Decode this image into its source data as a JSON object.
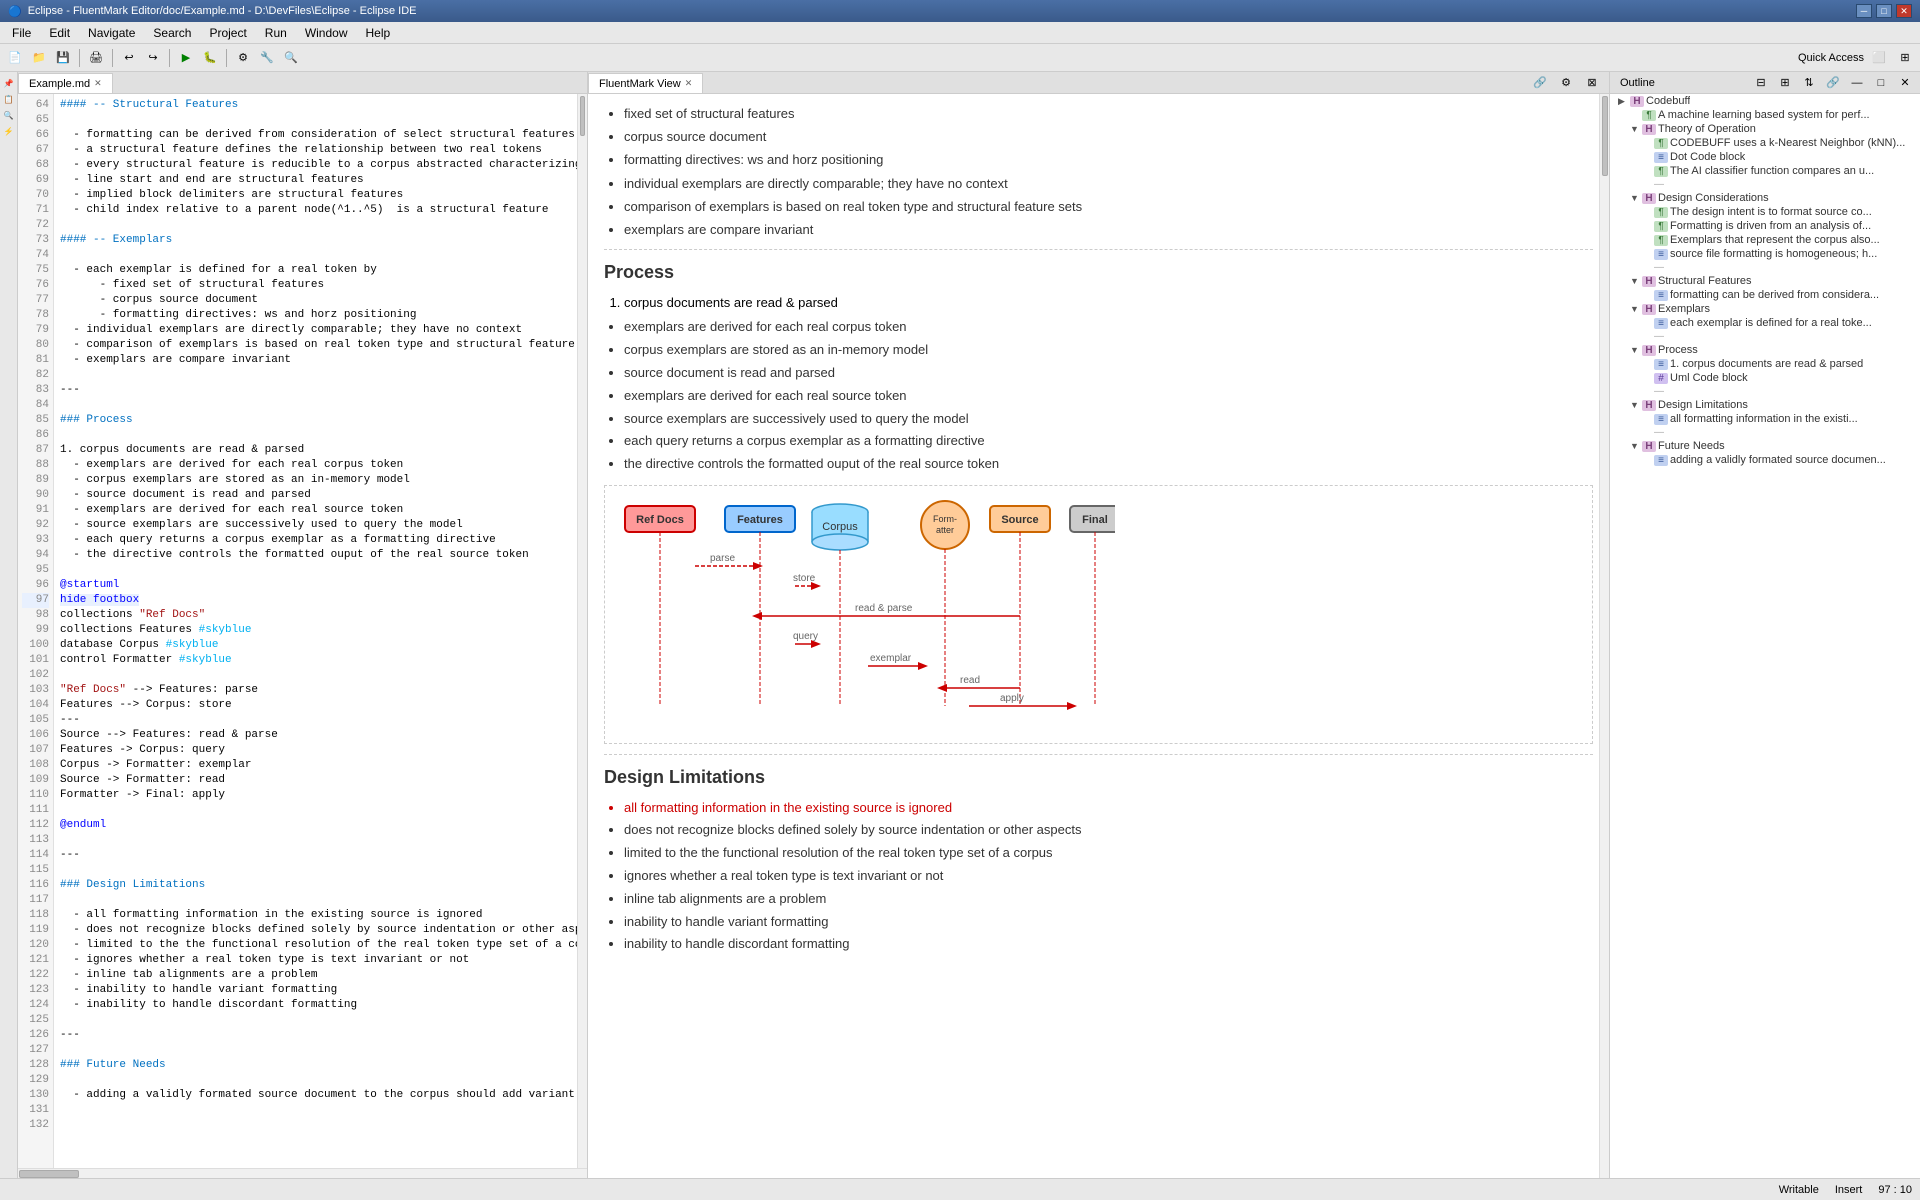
{
  "titlebar": {
    "title": "Eclipse - FluentMark Editor/doc/Example.md - D:\\DevFiles\\Eclipse - Eclipse IDE",
    "icon": "eclipse-icon",
    "buttons": [
      "minimize",
      "maximize",
      "close"
    ]
  },
  "menubar": {
    "items": [
      "File",
      "Edit",
      "Navigate",
      "Search",
      "Project",
      "Run",
      "Window",
      "Help"
    ]
  },
  "toolbar": {
    "quick_access_label": "Quick Access"
  },
  "editor": {
    "tab_label": "Example.md",
    "lines": [
      {
        "num": 64,
        "text": "#### -- Structural Features",
        "type": "heading"
      },
      {
        "num": 65,
        "text": ""
      },
      {
        "num": 66,
        "text": "  - formatting can be derived from consideration of select structural features"
      },
      {
        "num": 67,
        "text": "  - a structural feature defines the relationship between two real tokens"
      },
      {
        "num": 68,
        "text": "  - every structural feature is reducible to a corpus abstracted characterizing int"
      },
      {
        "num": 69,
        "text": "  - line start and end are structural features"
      },
      {
        "num": 70,
        "text": "  - implied block delimiters are structural features"
      },
      {
        "num": 71,
        "text": "  - child index relative to a parent node(^1..^5)  is a structural feature"
      },
      {
        "num": 72,
        "text": ""
      },
      {
        "num": 73,
        "text": "#### -- Exemplars",
        "type": "heading"
      },
      {
        "num": 74,
        "text": ""
      },
      {
        "num": 75,
        "text": "  - each exemplar is defined for a real token by"
      },
      {
        "num": 76,
        "text": "      - fixed set of structural features"
      },
      {
        "num": 77,
        "text": "      - corpus source document"
      },
      {
        "num": 78,
        "text": "      - formatting directives: ws and horz positioning"
      },
      {
        "num": 79,
        "text": "  - individual exemplars are directly comparable; they have no context"
      },
      {
        "num": 80,
        "text": "  - comparison of exemplars is based on real token type and structural feature sets"
      },
      {
        "num": 81,
        "text": "  - exemplars are compare invariant"
      },
      {
        "num": 82,
        "text": ""
      },
      {
        "num": 83,
        "text": "---"
      },
      {
        "num": 84,
        "text": ""
      },
      {
        "num": 85,
        "text": "### Process",
        "type": "heading"
      },
      {
        "num": 86,
        "text": ""
      },
      {
        "num": 87,
        "text": "1. corpus documents are read & parsed"
      },
      {
        "num": 88,
        "text": "  - exemplars are derived for each real corpus token"
      },
      {
        "num": 89,
        "text": "  - corpus exemplars are stored as an in-memory model"
      },
      {
        "num": 90,
        "text": "  - source document is read and parsed"
      },
      {
        "num": 91,
        "text": "  - exemplars are derived for each real source token"
      },
      {
        "num": 92,
        "text": "  - source exemplars are successively used to query the model"
      },
      {
        "num": 93,
        "text": "  - each query returns a corpus exemplar as a formatting directive"
      },
      {
        "num": 94,
        "text": "  - the directive controls the formatted ouput of the real source token"
      },
      {
        "num": 95,
        "text": ""
      },
      {
        "num": 96,
        "text": "@startuml",
        "type": "kw"
      },
      {
        "num": 97,
        "text": "hide footbox",
        "type": "kw"
      },
      {
        "num": 98,
        "text": "collections \"Ref Docs\"",
        "type": "uml"
      },
      {
        "num": 99,
        "text": "collections Features #skyblue",
        "type": "uml"
      },
      {
        "num": 100,
        "text": "database Corpus #skyblue",
        "type": "uml"
      },
      {
        "num": 101,
        "text": "control Formatter #skyblue",
        "type": "uml"
      },
      {
        "num": 102,
        "text": ""
      },
      {
        "num": 103,
        "text": "\"Ref Docs\" --> Features: parse",
        "type": "uml"
      },
      {
        "num": 104,
        "text": "Features --> Corpus: store",
        "type": "uml"
      },
      {
        "num": 105,
        "text": "---"
      },
      {
        "num": 106,
        "text": "Source --> Features: read & parse",
        "type": "uml"
      },
      {
        "num": 107,
        "text": "Features -> Corpus: query",
        "type": "uml"
      },
      {
        "num": 108,
        "text": "Corpus -> Formatter: exemplar",
        "type": "uml"
      },
      {
        "num": 109,
        "text": "Source -> Formatter: read",
        "type": "uml"
      },
      {
        "num": 110,
        "text": "Formatter -> Final: apply",
        "type": "uml"
      },
      {
        "num": 111,
        "text": ""
      },
      {
        "num": 112,
        "text": "@enduml",
        "type": "kw"
      },
      {
        "num": 113,
        "text": ""
      },
      {
        "num": 114,
        "text": "---"
      },
      {
        "num": 115,
        "text": ""
      },
      {
        "num": 116,
        "text": "### Design Limitations",
        "type": "heading"
      },
      {
        "num": 117,
        "text": ""
      },
      {
        "num": 118,
        "text": "  - all formatting information in the existing source is ignored"
      },
      {
        "num": 119,
        "text": "  - does not recognize blocks defined solely by source indentation or other aspects"
      },
      {
        "num": 120,
        "text": "  - limited to the the functional resolution of the real token type set of a corpus"
      },
      {
        "num": 121,
        "text": "  - ignores whether a real token type is text invariant or not"
      },
      {
        "num": 122,
        "text": "  - inline tab alignments are a problem"
      },
      {
        "num": 123,
        "text": "  - inability to handle variant formatting"
      },
      {
        "num": 124,
        "text": "  - inability to handle discordant formatting"
      },
      {
        "num": 125,
        "text": ""
      },
      {
        "num": 126,
        "text": "---"
      },
      {
        "num": 127,
        "text": ""
      },
      {
        "num": 128,
        "text": "### Future Needs",
        "type": "heading"
      },
      {
        "num": 129,
        "text": ""
      },
      {
        "num": 130,
        "text": "  - adding a validly formated source document to the corpus should add variant formatting cases"
      },
      {
        "num": 131,
        "text": ""
      },
      {
        "num": 132,
        "text": ""
      }
    ]
  },
  "preview": {
    "tab_label": "FluentMark View",
    "sections": {
      "structural_features_list": [
        "fixed set of structural features",
        "corpus source document",
        "formatting directives: ws and horz positioning"
      ],
      "exemplars_list": [
        "individual exemplars are directly comparable; they have no context",
        "comparison of exemplars is based on real token type and structural feature sets",
        "exemplars are compare invariant"
      ],
      "process_heading": "Process",
      "process_list": [
        "1. corpus documents are read & parsed",
        "exemplars are derived for each real corpus token",
        "corpus exemplars are stored as an in-memory model",
        "source document is read and parsed",
        "exemplars are derived for each real source token",
        "source exemplars are successively used to query the model",
        "each query returns a corpus exemplar as a formatting directive",
        "the directive controls the formatted ouput of the real source token"
      ],
      "uml_labels": {
        "ref_docs": "Ref Docs",
        "features": "Features",
        "corpus": "Corpus",
        "formatter": "Formatter",
        "source": "Source",
        "final": "Final"
      },
      "uml_arrows": {
        "parse": "parse",
        "store": "store",
        "read_parse": "read & parse",
        "query": "query",
        "exemplar": "exemplar",
        "read": "read",
        "apply": "apply"
      },
      "design_limitations_heading": "Design Limitations",
      "design_limitations_list": [
        "all formatting information in the existing source is ignored",
        "does not recognize blocks defined solely by source indentation or other aspects",
        "limited to the the functional resolution of the real token type set of a corpus",
        "ignores whether a real token type is text invariant or not",
        "inline tab alignments are a problem",
        "inability to handle variant formatting",
        "inability to handle discordant formatting"
      ]
    }
  },
  "outline": {
    "tab_label": "Outline",
    "items": [
      {
        "level": 1,
        "type": "root",
        "icon": "H",
        "text": "Codebuff",
        "arrow": "▶"
      },
      {
        "level": 2,
        "type": "p",
        "icon": "¶",
        "text": "A machine learning based system for perf..."
      },
      {
        "level": 2,
        "type": "H",
        "icon": "H",
        "text": "Theory of Operation",
        "arrow": "▼"
      },
      {
        "level": 3,
        "type": "p",
        "icon": "¶",
        "text": "CODEBUFF uses a k-Nearest Neighbor (kNN)..."
      },
      {
        "level": 3,
        "type": "list",
        "icon": "≡",
        "text": "Dot Code block"
      },
      {
        "level": 3,
        "type": "p",
        "icon": "¶",
        "text": "The AI classifier function compares an u..."
      },
      {
        "level": 3,
        "type": "sep",
        "icon": "—",
        "text": "—"
      },
      {
        "level": 2,
        "type": "H",
        "icon": "H",
        "text": "Design Considerations",
        "arrow": "▼"
      },
      {
        "level": 3,
        "type": "p",
        "icon": "¶",
        "text": "The design intent is to format source co..."
      },
      {
        "level": 3,
        "type": "p",
        "icon": "¶",
        "text": "Formatting is driven from an analysis of..."
      },
      {
        "level": 3,
        "type": "p",
        "icon": "¶",
        "text": "Exemplars that represent the corpus also..."
      },
      {
        "level": 3,
        "type": "list",
        "icon": "≡",
        "text": "source file formatting is homogeneous; h..."
      },
      {
        "level": 3,
        "type": "sep",
        "icon": "—",
        "text": "—"
      },
      {
        "level": 2,
        "type": "H",
        "icon": "H",
        "text": "Structural Features",
        "arrow": "▼"
      },
      {
        "level": 3,
        "type": "list",
        "icon": "≡",
        "text": "formatting can be derived from considera..."
      },
      {
        "level": 2,
        "type": "H",
        "icon": "H",
        "text": "Exemplars",
        "arrow": "▼"
      },
      {
        "level": 3,
        "type": "list",
        "icon": "≡",
        "text": "each exemplar is defined for a real toke..."
      },
      {
        "level": 3,
        "type": "sep",
        "icon": "—",
        "text": "—"
      },
      {
        "level": 2,
        "type": "H",
        "icon": "H",
        "text": "Process",
        "arrow": "▼"
      },
      {
        "level": 3,
        "type": "list",
        "icon": "≡",
        "text": "1. corpus documents are read & parsed"
      },
      {
        "level": 3,
        "type": "uml",
        "icon": "#",
        "text": "Uml Code block"
      },
      {
        "level": 3,
        "type": "sep",
        "icon": "—",
        "text": "—"
      },
      {
        "level": 2,
        "type": "H",
        "icon": "H",
        "text": "Design Limitations",
        "arrow": "▼"
      },
      {
        "level": 3,
        "type": "list",
        "icon": "≡",
        "text": "all formatting information in the existi..."
      },
      {
        "level": 3,
        "type": "sep",
        "icon": "—",
        "text": "—"
      },
      {
        "level": 2,
        "type": "H",
        "icon": "H",
        "text": "Future Needs",
        "arrow": "▼"
      },
      {
        "level": 3,
        "type": "list",
        "icon": "≡",
        "text": "adding a validly formated source documen..."
      }
    ]
  },
  "statusbar": {
    "mode": "Writable",
    "insert": "Insert",
    "position": "97 : 10"
  }
}
